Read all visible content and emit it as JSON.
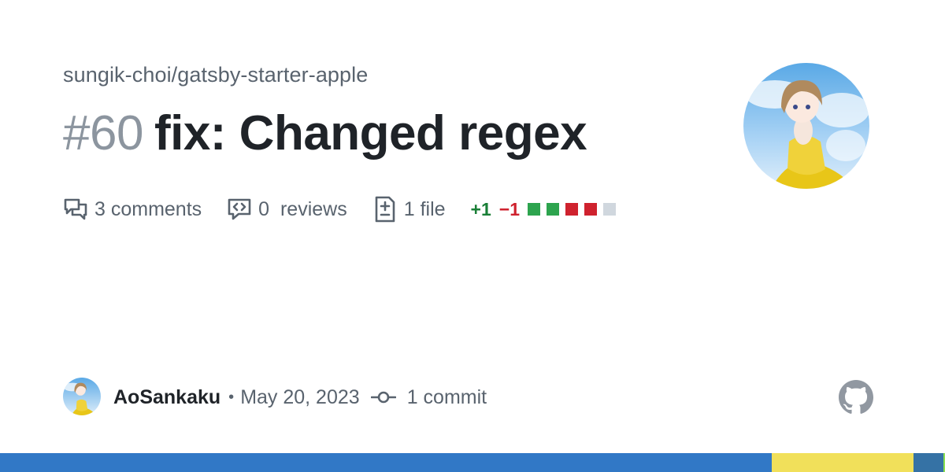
{
  "repo": {
    "full_name": "sungik-choi/gatsby-starter-apple"
  },
  "pr": {
    "number": "#60",
    "title": "fix: Changed regex"
  },
  "stats": {
    "comments": "3 comments",
    "reviews": "0  reviews",
    "files": "1 file",
    "additions": "+1",
    "deletions": "−1"
  },
  "diff_squares": [
    "#2da44e",
    "#2da44e",
    "#cf222e",
    "#cf222e",
    "#d0d7de"
  ],
  "author": {
    "name": "AoSankaku",
    "date": "May 20, 2023",
    "separator": "•"
  },
  "commits": {
    "label": "1 commit"
  },
  "icons": {
    "comments": "comment-discussion-icon",
    "reviews": "code-review-icon",
    "files": "file-diff-icon",
    "commit": "git-commit-icon",
    "brand": "github-mark-icon"
  },
  "language_bar": [
    {
      "color": "#3178c6",
      "share": 0.817
    },
    {
      "color": "#f1e05a",
      "share": 0.15
    },
    {
      "color": "#3572a5",
      "share": 0.031
    },
    {
      "color": "#89e051",
      "share": 0.002
    }
  ]
}
